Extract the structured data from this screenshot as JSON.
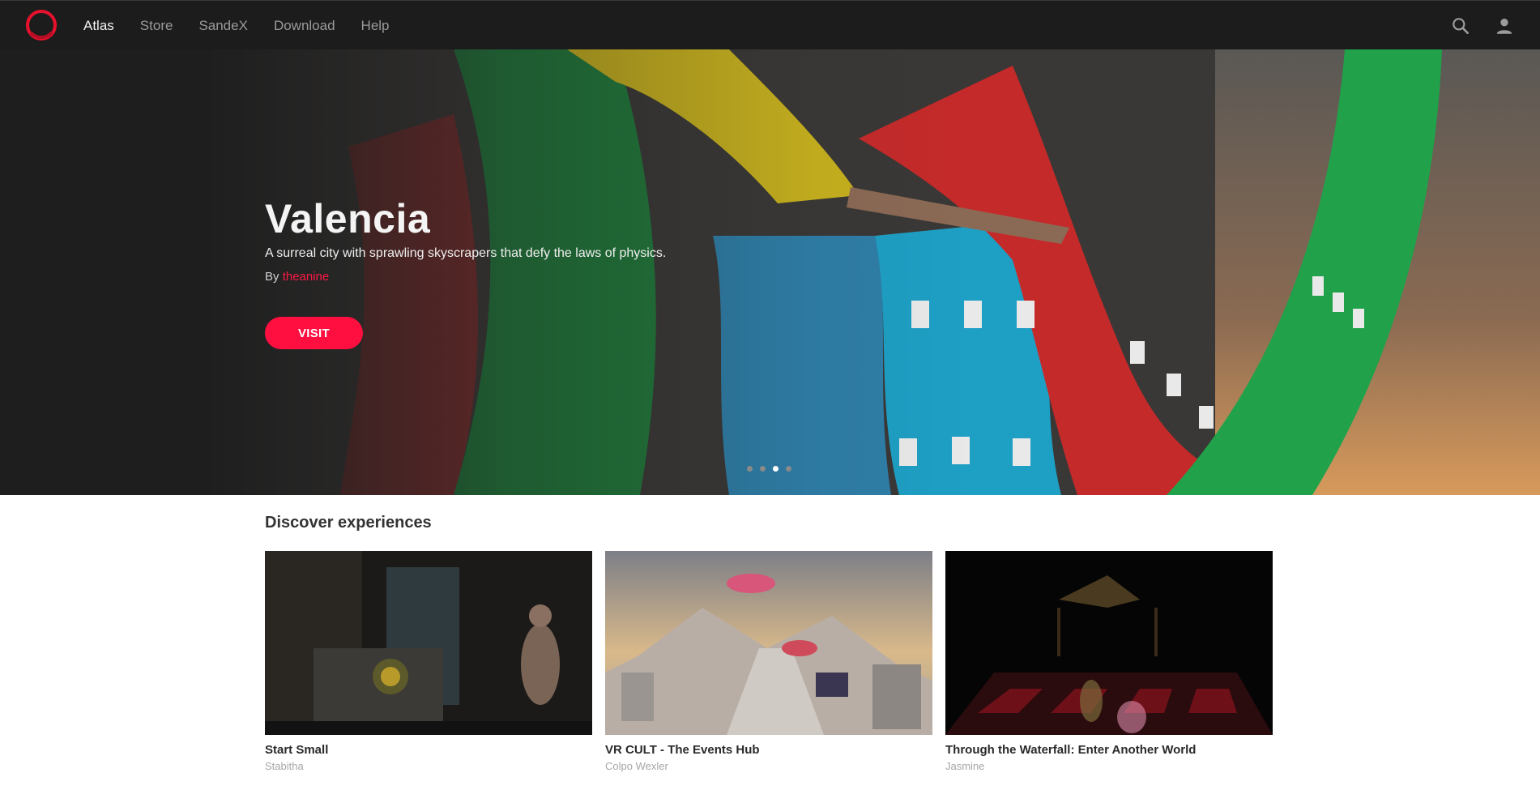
{
  "nav": {
    "logo": "oculus-ring-logo",
    "links": [
      {
        "label": "Atlas",
        "active": true
      },
      {
        "label": "Store",
        "active": false
      },
      {
        "label": "SandeX",
        "active": false
      },
      {
        "label": "Download",
        "active": false
      },
      {
        "label": "Help",
        "active": false
      }
    ],
    "icons": [
      "search-icon",
      "account-icon"
    ]
  },
  "hero": {
    "title": "Valencia",
    "description": "A surreal city with sprawling skyscrapers that defy the laws of physics.",
    "by_prefix": "By",
    "author": "theanine",
    "visit_label": "VISIT",
    "slides": 4,
    "active_slide": 3
  },
  "discover": {
    "title": "Discover experiences",
    "items": [
      {
        "name": "Start Small",
        "creator": "Stabitha"
      },
      {
        "name": "VR CULT - The Events Hub",
        "creator": "Colpo Wexler"
      },
      {
        "name": "Through the Waterfall: Enter Another World",
        "creator": "Jasmine"
      }
    ]
  },
  "colors": {
    "nav_bg": "#1c1c1c",
    "accent": "#ff0f3f",
    "author_link": "#ff1744"
  }
}
